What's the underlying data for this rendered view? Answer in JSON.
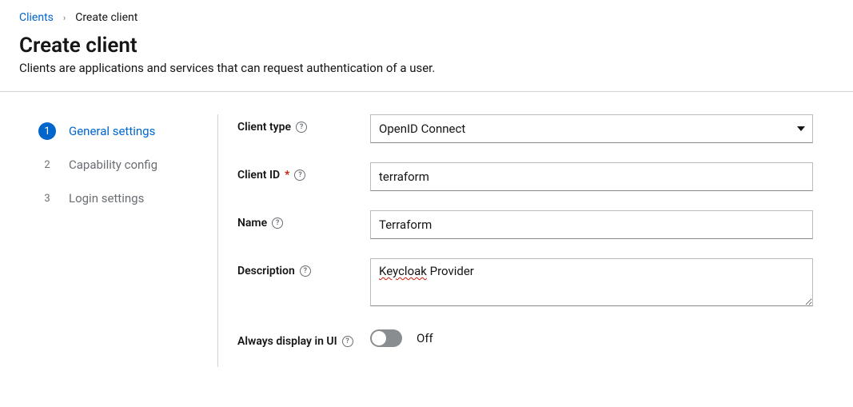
{
  "breadcrumb": {
    "parent": "Clients",
    "current": "Create client"
  },
  "header": {
    "title": "Create client",
    "subtitle": "Clients are applications and services that can request authentication of a user."
  },
  "wizard": {
    "steps": [
      {
        "num": "1",
        "label": "General settings"
      },
      {
        "num": "2",
        "label": "Capability config"
      },
      {
        "num": "3",
        "label": "Login settings"
      }
    ]
  },
  "form": {
    "client_type": {
      "label": "Client type",
      "value": "OpenID Connect"
    },
    "client_id": {
      "label": "Client ID",
      "value": "terraform"
    },
    "name": {
      "label": "Name",
      "value": "Terraform"
    },
    "description": {
      "label": "Description",
      "value_word1": "Keycloak",
      "value_rest": " Provider",
      "value": "Keycloak Provider"
    },
    "always_display": {
      "label": "Always display in UI",
      "state": "Off"
    }
  }
}
